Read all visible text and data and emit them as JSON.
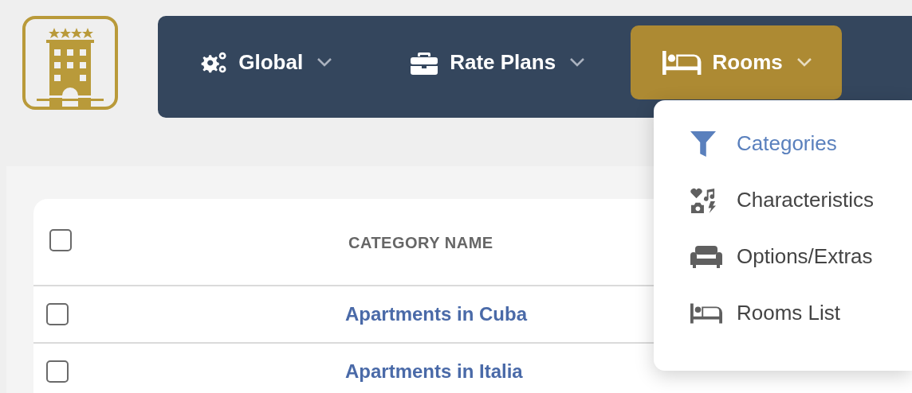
{
  "nav": {
    "items": [
      {
        "label": "Global",
        "kind": "gears",
        "selected": false
      },
      {
        "label": "Rate Plans",
        "kind": "briefcase",
        "selected": false
      },
      {
        "label": "Rooms",
        "kind": "bed",
        "selected": true
      }
    ]
  },
  "rooms_menu": {
    "items": [
      {
        "label": "Categories",
        "kind": "funnel",
        "selected": true
      },
      {
        "label": "Characteristics",
        "kind": "mixed",
        "selected": false
      },
      {
        "label": "Options/Extras",
        "kind": "sofa",
        "selected": false
      },
      {
        "label": "Rooms List",
        "kind": "bed",
        "selected": false
      }
    ]
  },
  "table": {
    "header_checked": false,
    "columns": [
      "CATEGORY NAME"
    ],
    "rows": [
      {
        "name": "Apartments in Cuba",
        "checked": false
      },
      {
        "name": "Apartments in Italia",
        "checked": false
      }
    ]
  }
}
